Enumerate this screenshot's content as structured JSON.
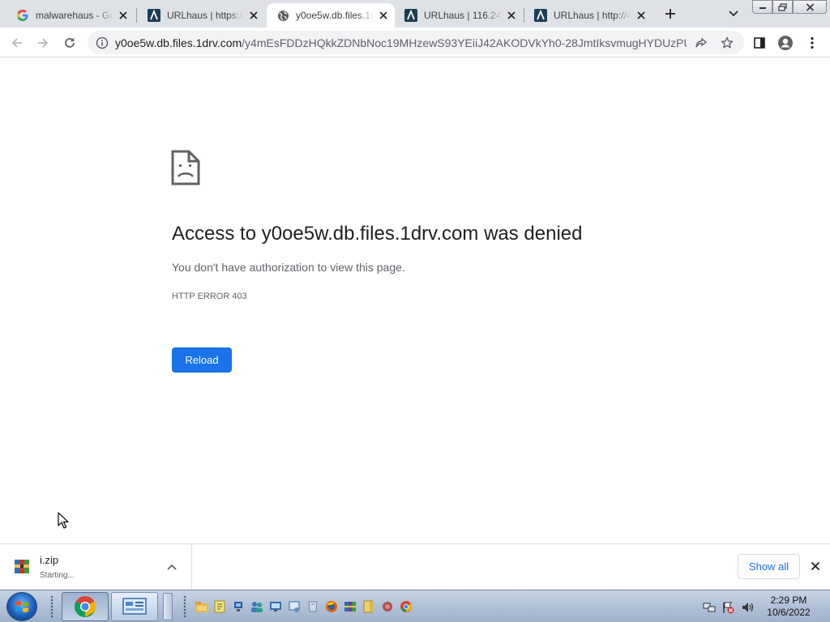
{
  "tabs": [
    {
      "title": "malwarehaus - Go",
      "favicon": "google-g-icon",
      "active": false
    },
    {
      "title": "URLhaus | https://",
      "favicon": "urlhaus-icon",
      "active": false
    },
    {
      "title": "y0oe5w.db.files.1d",
      "favicon": "globe-icon",
      "active": true
    },
    {
      "title": "URLhaus | 116.24.",
      "favicon": "urlhaus-icon",
      "active": false
    },
    {
      "title": "URLhaus | http://4",
      "favicon": "urlhaus-icon",
      "active": false
    }
  ],
  "omnibox": {
    "host": "y0oe5w.db.files.1drv.com",
    "path": "/y4mEsFDDzHQkkZDNbNoc19MHzewS93YEiiJ42AKODVkYh0-28JmtIksvmugHYDUzPU4..."
  },
  "error_page": {
    "title": "Access to y0oe5w.db.files.1drv.com was denied",
    "description": "You don't have authorization to view this page.",
    "error_code": "HTTP ERROR 403",
    "reload_label": "Reload"
  },
  "download_shelf": {
    "item_name": "i.zip",
    "item_status": "Starting...",
    "show_all_label": "Show all"
  },
  "taskbar": {
    "time": "2:29 PM",
    "date": "10/6/2022"
  },
  "colors": {
    "accent": "#1a73e8",
    "tabstrip": "#dee1e6",
    "text_primary": "#202124",
    "text_secondary": "#5f6368"
  }
}
